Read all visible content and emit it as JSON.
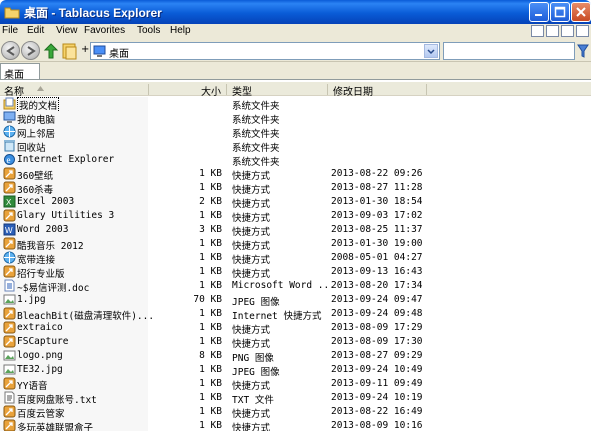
{
  "window": {
    "title": "桌面 - Tablacus Explorer"
  },
  "menu": [
    "File",
    "Edit",
    "View",
    "Favorites",
    "Tools",
    "Help"
  ],
  "address": {
    "value": "桌面"
  },
  "tabs": [
    {
      "label": "桌面"
    }
  ],
  "columns": {
    "name": "名称",
    "size": "大小",
    "type": "类型",
    "modified": "修改日期"
  },
  "rows": [
    {
      "name": "我的文档",
      "size": "",
      "type": "系统文件夹",
      "date": "",
      "icon": "documents-folder-icon",
      "selected": true
    },
    {
      "name": "我的电脑",
      "size": "",
      "type": "系统文件夹",
      "date": "",
      "icon": "computer-icon"
    },
    {
      "name": "网上邻居",
      "size": "",
      "type": "系统文件夹",
      "date": "",
      "icon": "network-icon"
    },
    {
      "name": "回收站",
      "size": "",
      "type": "系统文件夹",
      "date": "",
      "icon": "recycle-bin-icon"
    },
    {
      "name": "Internet Explorer",
      "size": "",
      "type": "系统文件夹",
      "date": "",
      "icon": "ie-icon"
    },
    {
      "name": "360壁纸",
      "size": "1 KB",
      "type": "快捷方式",
      "date": "2013-08-22 09:26",
      "icon": "shortcut-icon"
    },
    {
      "name": "360杀毒",
      "size": "1 KB",
      "type": "快捷方式",
      "date": "2013-08-27 11:28",
      "icon": "shortcut-icon"
    },
    {
      "name": "Excel 2003",
      "size": "2 KB",
      "type": "快捷方式",
      "date": "2013-01-30 18:54",
      "icon": "excel-icon"
    },
    {
      "name": "Glary Utilities 3",
      "size": "1 KB",
      "type": "快捷方式",
      "date": "2013-09-03 17:02",
      "icon": "shortcut-icon"
    },
    {
      "name": "Word 2003",
      "size": "3 KB",
      "type": "快捷方式",
      "date": "2013-08-25 11:37",
      "icon": "word-icon"
    },
    {
      "name": "酷我音乐 2012",
      "size": "1 KB",
      "type": "快捷方式",
      "date": "2013-01-30 19:00",
      "icon": "shortcut-icon"
    },
    {
      "name": "宽带连接",
      "size": "1 KB",
      "type": "快捷方式",
      "date": "2008-05-01 04:27",
      "icon": "network-icon"
    },
    {
      "name": "招行专业版",
      "size": "1 KB",
      "type": "快捷方式",
      "date": "2013-09-13 16:43",
      "icon": "shortcut-icon"
    },
    {
      "name": "~$易信评测.doc",
      "size": "1 KB",
      "type": "Microsoft Word ...",
      "date": "2013-08-20 17:34",
      "icon": "document-icon"
    },
    {
      "name": "1.jpg",
      "size": "70 KB",
      "type": "JPEG 图像",
      "date": "2013-09-24 09:47",
      "icon": "image-icon"
    },
    {
      "name": "BleachBit(磁盘清理软件)...",
      "size": "1 KB",
      "type": "Internet 快捷方式",
      "date": "2013-09-24 09:48",
      "icon": "shortcut-icon"
    },
    {
      "name": "extraico",
      "size": "1 KB",
      "type": "快捷方式",
      "date": "2013-08-09 17:29",
      "icon": "shortcut-icon"
    },
    {
      "name": "FSCapture",
      "size": "1 KB",
      "type": "快捷方式",
      "date": "2013-08-09 17:30",
      "icon": "shortcut-icon"
    },
    {
      "name": "logo.png",
      "size": "8 KB",
      "type": "PNG 图像",
      "date": "2013-08-27 09:29",
      "icon": "image-icon"
    },
    {
      "name": "TE32.jpg",
      "size": "1 KB",
      "type": "JPEG 图像",
      "date": "2013-09-24 10:49",
      "icon": "image-icon"
    },
    {
      "name": "YY语音",
      "size": "1 KB",
      "type": "快捷方式",
      "date": "2013-09-11 09:49",
      "icon": "shortcut-icon"
    },
    {
      "name": "百度网盘账号.txt",
      "size": "1 KB",
      "type": "TXT 文件",
      "date": "2013-09-24 10:19",
      "icon": "text-file-icon"
    },
    {
      "name": "百度云管家",
      "size": "1 KB",
      "type": "快捷方式",
      "date": "2013-08-22 16:49",
      "icon": "shortcut-icon"
    },
    {
      "name": "多玩英雄联盟盒子",
      "size": "1 KB",
      "type": "快捷方式",
      "date": "2013-08-09 10:16",
      "icon": "shortcut-icon"
    }
  ],
  "colors": {
    "title_bar": "#0a5cd7",
    "chrome": "#ece9d8",
    "header": "#ebeadb"
  }
}
